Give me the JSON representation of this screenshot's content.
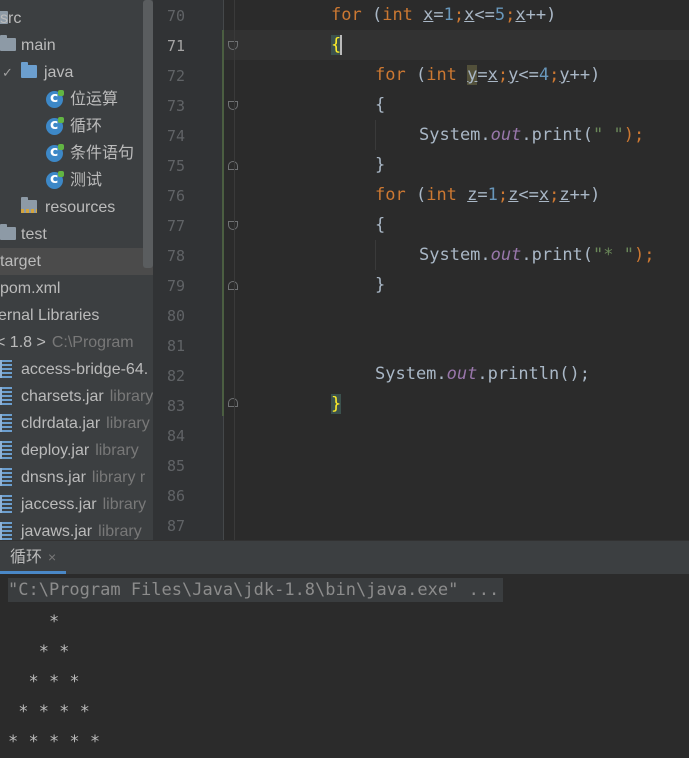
{
  "tree": {
    "items": [
      {
        "label": "src"
      },
      {
        "label": "main"
      },
      {
        "label": "java"
      },
      {
        "label": "位运算"
      },
      {
        "label": "循环"
      },
      {
        "label": "条件语句"
      },
      {
        "label": "测试"
      },
      {
        "label": "resources"
      },
      {
        "label": "test"
      },
      {
        "label": "target"
      },
      {
        "label": "pom.xml"
      },
      {
        "label": "ernal Libraries"
      },
      {
        "label": "< 1.8 >",
        "sub": "C:\\Program"
      },
      {
        "label": "access-bridge-64."
      },
      {
        "label": "charsets.jar",
        "sub": "library"
      },
      {
        "label": "cldrdata.jar",
        "sub": "library"
      },
      {
        "label": "deploy.jar",
        "sub": "library"
      },
      {
        "label": "dnsns.jar",
        "sub": "library r"
      },
      {
        "label": "jaccess.jar",
        "sub": "library"
      },
      {
        "label": "javaws.jar",
        "sub": "library"
      }
    ]
  },
  "editor": {
    "line_numbers": [
      "70",
      "71",
      "72",
      "73",
      "74",
      "75",
      "76",
      "77",
      "78",
      "79",
      "80",
      "81",
      "82",
      "83",
      "84",
      "85",
      "86",
      "87"
    ],
    "current_line": "71",
    "code": {
      "l70": {
        "kw": "for",
        "p1": " (",
        "ty": "int",
        "sp": " ",
        "v1": "x",
        "eq": "=",
        "n1": "1",
        "sc1": ";",
        "v2": "x",
        "op": "<=",
        "n2": "5",
        "sc2": ";",
        "v3": "x",
        "inc": "++)"
      },
      "l71": {
        "brace": "{"
      },
      "l72": {
        "kw": "for",
        "p1": " (",
        "ty": "int",
        "sp": " ",
        "v1": "y",
        "eq": "=",
        "v1b": "x",
        "sc1": ";",
        "v2": "y",
        "op": "<=",
        "n2": "4",
        "sc2": ";",
        "v3": "y",
        "inc": "++)"
      },
      "l73": {
        "brace": "{"
      },
      "l74": {
        "obj": "System.",
        "fld": "out",
        "call": ".print(",
        "str": "\" \"",
        "end": ");"
      },
      "l75": {
        "brace": "}"
      },
      "l76": {
        "kw": "for",
        "p1": " (",
        "ty": "int",
        "sp": " ",
        "v1": "z",
        "eq": "=",
        "n1": "1",
        "sc1": ";",
        "v2": "z",
        "op": "<=",
        "v2b": "x",
        "sc2": ";",
        "v3": "z",
        "inc": "++)"
      },
      "l77": {
        "brace": "{"
      },
      "l78": {
        "obj": "System.",
        "fld": "out",
        "call": ".print(",
        "str": "\"* \"",
        "end": ");"
      },
      "l79": {
        "brace": "}"
      },
      "l82": {
        "obj": "System.",
        "fld": "out",
        "call": ".println();"
      },
      "l83": {
        "brace": "}"
      }
    }
  },
  "run": {
    "tab_label": "循环",
    "tab_close": "×",
    "command": "\"C:\\Program Files\\Java\\jdk-1.8\\bin\\java.exe\" ...",
    "output": [
      "    *",
      "   * *",
      "  * * *",
      " * * * *",
      "* * * * *"
    ]
  },
  "colors": {
    "keyword": "#cc7832",
    "number": "#6897bb",
    "string": "#6a8759",
    "field": "#9876aa",
    "text": "#a9b7c6"
  }
}
